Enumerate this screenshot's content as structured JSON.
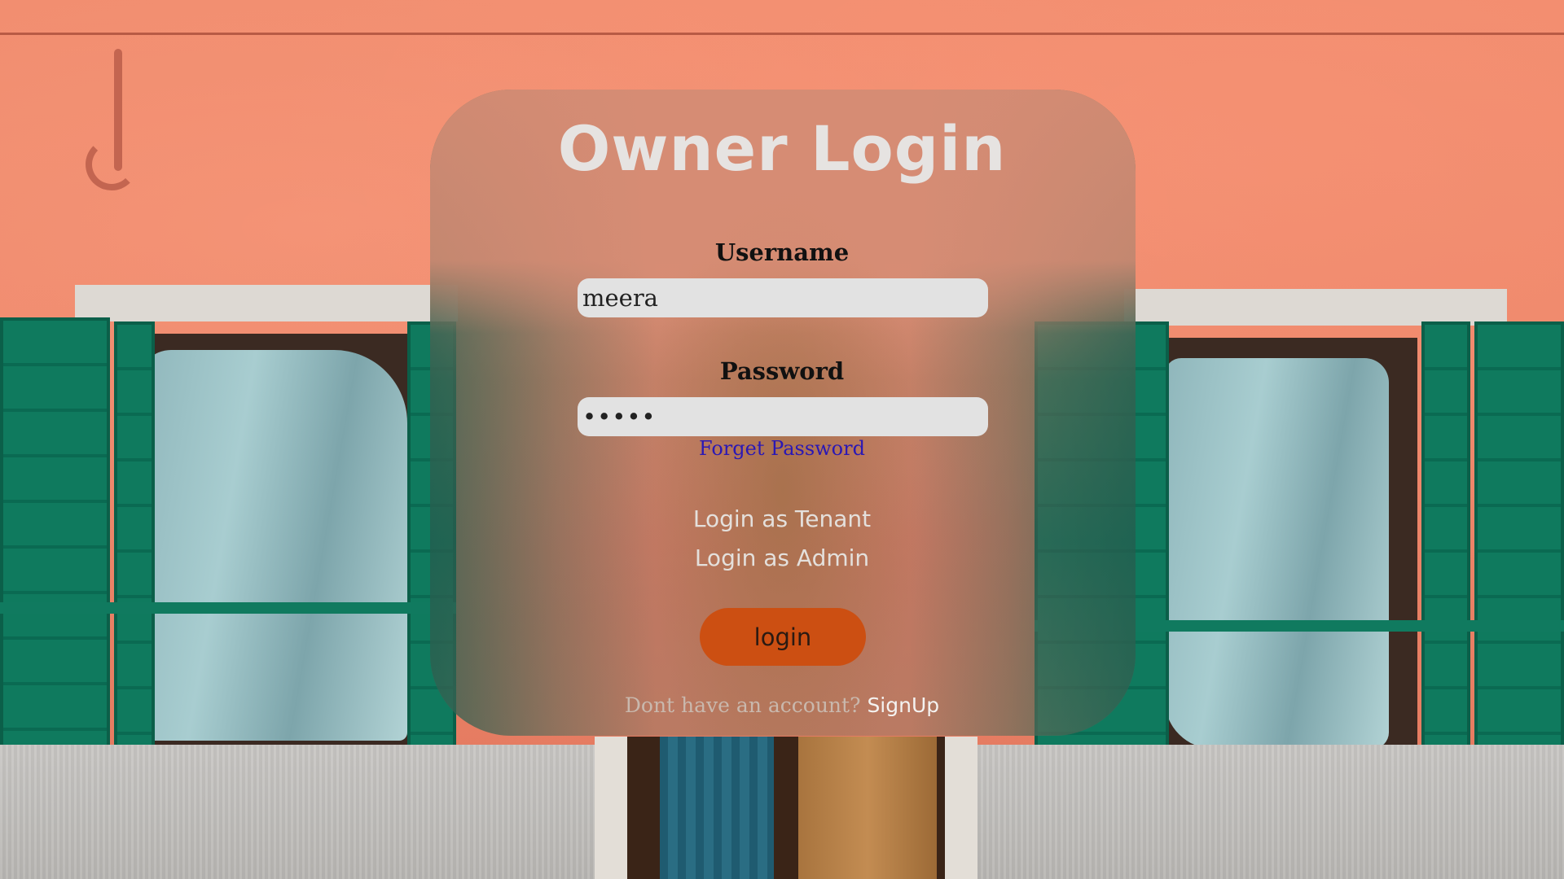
{
  "page": {
    "title": "Owner Login"
  },
  "form": {
    "username_label": "Username",
    "username_value": "meera",
    "password_label": "Password",
    "password_value": "•••••",
    "forget_password": "Forget Password"
  },
  "alt_logins": {
    "tenant": "Login as Tenant",
    "admin": "Login as Admin"
  },
  "actions": {
    "login_label": "login"
  },
  "signup": {
    "prompt": "Dont have an account?",
    "link": "SignUp"
  },
  "colors": {
    "accent_button": "#cc4f12",
    "link_blue": "#2a18b5",
    "title": "#e6e3e1"
  }
}
